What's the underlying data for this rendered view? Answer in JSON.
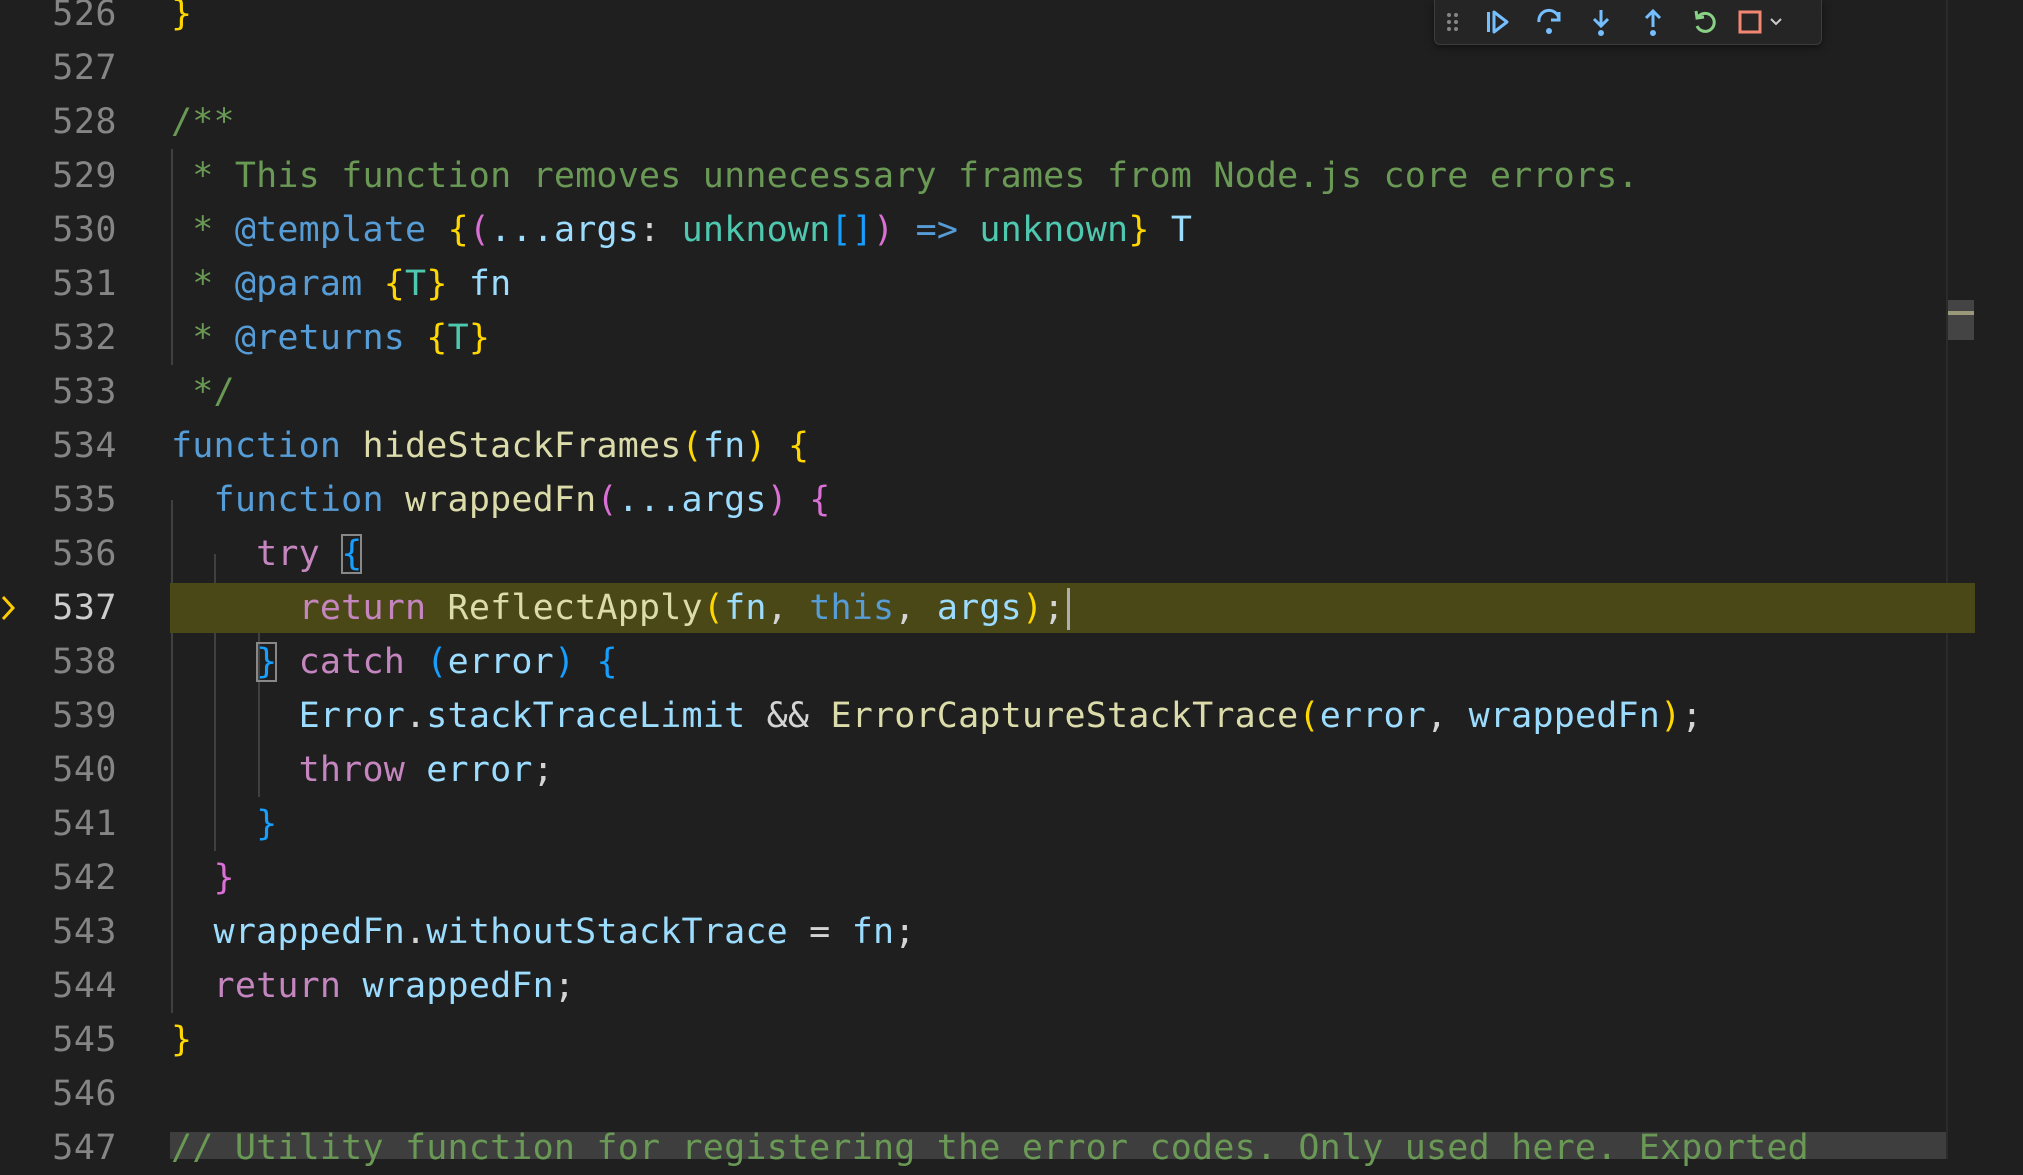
{
  "editor": {
    "lines": [
      {
        "n": "526",
        "active": false
      },
      {
        "n": "527",
        "active": false
      },
      {
        "n": "528",
        "active": false
      },
      {
        "n": "529",
        "active": false
      },
      {
        "n": "530",
        "active": false
      },
      {
        "n": "531",
        "active": false
      },
      {
        "n": "532",
        "active": false
      },
      {
        "n": "533",
        "active": false
      },
      {
        "n": "534",
        "active": false
      },
      {
        "n": "535",
        "active": false
      },
      {
        "n": "536",
        "active": false
      },
      {
        "n": "537",
        "active": true
      },
      {
        "n": "538",
        "active": false
      },
      {
        "n": "539",
        "active": false
      },
      {
        "n": "540",
        "active": false
      },
      {
        "n": "541",
        "active": false
      },
      {
        "n": "542",
        "active": false
      },
      {
        "n": "543",
        "active": false
      },
      {
        "n": "544",
        "active": false
      },
      {
        "n": "545",
        "active": false
      },
      {
        "n": "546",
        "active": false
      },
      {
        "n": "547",
        "active": false
      }
    ],
    "current_line": "537",
    "breakpoint_icon": "debug-stackframe-arrow-icon",
    "code": {
      "l526": "}",
      "l528": "/**",
      "l529": " * This function removes unnecessary frames from Node.js core errors.",
      "l530_star": " * ",
      "l530_tag": "@template",
      "l530_space": " ",
      "l530_ob": "{",
      "l530_op": "(",
      "l530_args": "...args",
      "l530_colon": ": ",
      "l530_unk1": "unknown",
      "l530_arr": "[]",
      "l530_cp": ")",
      "l530_arrow": " => ",
      "l530_unk2": "unknown",
      "l530_cb": "}",
      "l530_T": " T",
      "l531_star": " * ",
      "l531_tag": "@param",
      "l531_space": " ",
      "l531_ob": "{",
      "l531_T": "T",
      "l531_cb": "}",
      "l531_fn": " fn",
      "l532_star": " * ",
      "l532_tag": "@returns",
      "l532_space": " ",
      "l532_ob": "{",
      "l532_T": "T",
      "l532_cb": "}",
      "l533": " */",
      "l534_kw": "function",
      "l534_name": " hideStackFrames",
      "l534_op": "(",
      "l534_fn": "fn",
      "l534_cp": ")",
      "l534_sp": " ",
      "l534_ob": "{",
      "l535_indent": "  ",
      "l535_kw": "function",
      "l535_name": " wrappedFn",
      "l535_op": "(",
      "l535_args": "...args",
      "l535_cp": ")",
      "l535_sp": " ",
      "l535_ob": "{",
      "l536_indent": "    ",
      "l536_kw": "try",
      "l536_sp": " ",
      "l536_ob": "{",
      "l537_indent": "      ",
      "l537_kw": "return",
      "l537_name": " ReflectApply",
      "l537_op": "(",
      "l537_fn": "fn",
      "l537_c1": ", ",
      "l537_this": "this",
      "l537_c2": ", ",
      "l537_args": "args",
      "l537_cp": ")",
      "l537_semi": ";",
      "l538_indent": "    ",
      "l538_cb": "}",
      "l538_sp": " ",
      "l538_kw": "catch",
      "l538_sp2": " ",
      "l538_op": "(",
      "l538_err": "error",
      "l538_cp": ")",
      "l538_sp3": " ",
      "l538_ob": "{",
      "l539_indent": "      ",
      "l539_obj": "Error",
      "l539_dot": ".",
      "l539_prop": "stackTraceLimit",
      "l539_and": " && ",
      "l539_fn": "ErrorCaptureStackTrace",
      "l539_op": "(",
      "l539_err": "error",
      "l539_c": ", ",
      "l539_wf": "wrappedFn",
      "l539_cp": ")",
      "l539_semi": ";",
      "l540_indent": "      ",
      "l540_kw": "throw",
      "l540_err": " error",
      "l540_semi": ";",
      "l541_indent": "    ",
      "l541_cb": "}",
      "l542_indent": "  ",
      "l542_cb": "}",
      "l543_indent": "  ",
      "l543_obj": "wrappedFn",
      "l543_dot": ".",
      "l543_prop": "withoutStackTrace",
      "l543_eq": " = ",
      "l543_fn": "fn",
      "l543_semi": ";",
      "l544_indent": "  ",
      "l544_kw": "return",
      "l544_wf": " wrappedFn",
      "l544_semi": ";",
      "l545": "}",
      "l547": "// Utility function for registering the error codes. Only used here. Exported"
    }
  },
  "debug_toolbar": {
    "buttons": [
      {
        "name": "drag-handle-icon"
      },
      {
        "name": "continue-icon"
      },
      {
        "name": "step-over-icon"
      },
      {
        "name": "step-into-icon"
      },
      {
        "name": "step-out-icon"
      },
      {
        "name": "restart-icon"
      },
      {
        "name": "stop-icon"
      }
    ],
    "colors": {
      "blue": "#75beff",
      "green": "#89d185",
      "red": "#f48771",
      "grip": "#858585"
    }
  },
  "theme": {
    "background": "#1f1f1f",
    "current_line_bg": "#4b4818",
    "breakpoint_color": "#ffcc00"
  }
}
